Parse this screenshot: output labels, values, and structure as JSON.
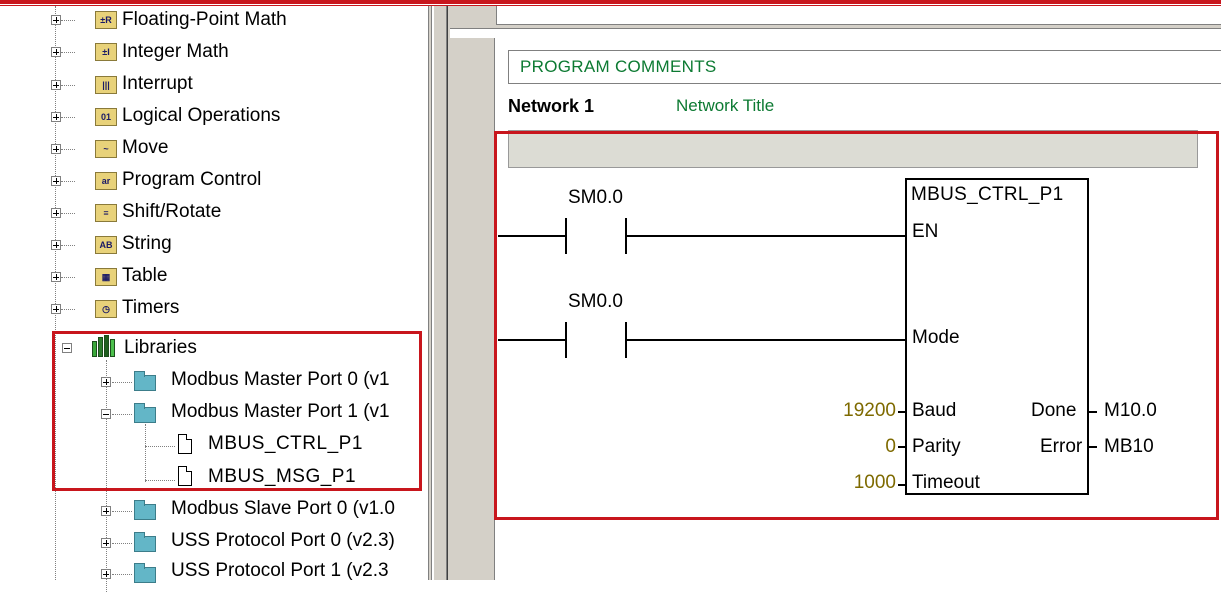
{
  "tree": {
    "instructions": [
      {
        "label": "Floating-Point Math",
        "icon": "floating-point-math-icon",
        "glyph": "±R"
      },
      {
        "label": "Integer Math",
        "icon": "integer-math-icon",
        "glyph": "±I"
      },
      {
        "label": "Interrupt",
        "icon": "interrupt-icon",
        "glyph": "|||"
      },
      {
        "label": "Logical Operations",
        "icon": "logical-operations-icon",
        "glyph": "01"
      },
      {
        "label": "Move",
        "icon": "move-icon",
        "glyph": "~"
      },
      {
        "label": "Program Control",
        "icon": "program-control-icon",
        "glyph": "ar"
      },
      {
        "label": "Shift/Rotate",
        "icon": "shift-rotate-icon",
        "glyph": "≡"
      },
      {
        "label": "String",
        "icon": "string-icon",
        "glyph": "AB"
      },
      {
        "label": "Table",
        "icon": "table-icon",
        "glyph": "▦"
      },
      {
        "label": "Timers",
        "icon": "timers-icon",
        "glyph": "◷"
      }
    ],
    "libraries": {
      "label": "Libraries",
      "items": [
        {
          "label": "Modbus Master Port 0 (v1",
          "expanded": false
        },
        {
          "label": "Modbus Master Port 1 (v1",
          "expanded": true,
          "children": [
            "MBUS_CTRL_P1",
            "MBUS_MSG_P1"
          ]
        },
        {
          "label": "Modbus Slave Port 0 (v1.0",
          "expanded": false
        },
        {
          "label": "USS Protocol Port 0 (v2.3)",
          "expanded": false
        },
        {
          "label": "USS Protocol Port 1 (v2.3",
          "expanded": false
        }
      ]
    }
  },
  "editor": {
    "program_comments": "PROGRAM COMMENTS",
    "network_label": "Network 1",
    "network_title": "Network Title",
    "contacts": [
      "SM0.0",
      "SM0.0"
    ],
    "block": {
      "name": "MBUS_CTRL_P1",
      "inputs": [
        {
          "pin": "EN",
          "value": ""
        },
        {
          "pin": "Mode",
          "value": ""
        },
        {
          "pin": "Baud",
          "value": "19200"
        },
        {
          "pin": "Parity",
          "value": "0"
        },
        {
          "pin": "Timeout",
          "value": "1000"
        }
      ],
      "outputs": [
        {
          "pin": "Done",
          "value": "M10.0"
        },
        {
          "pin": "Error",
          "value": "MB10"
        }
      ]
    }
  },
  "colors": {
    "highlight": "#c8161d",
    "comment_green": "#0c7a32",
    "value_olive": "#7e6a00",
    "folder_teal": "#63b6c7"
  }
}
